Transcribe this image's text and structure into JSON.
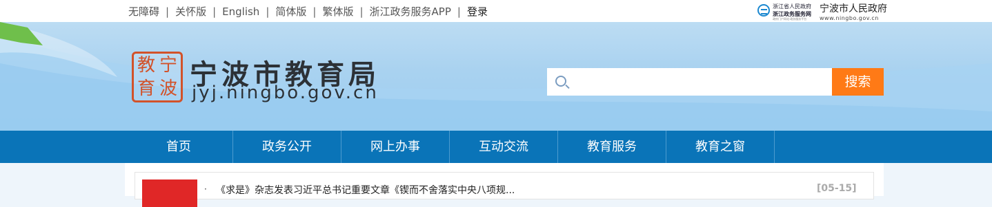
{
  "topbar": {
    "links": [
      "无障碍",
      "关怀版",
      "English",
      "简体版",
      "繁体版",
      "浙江政务服务APP"
    ],
    "separator": "|",
    "login": "登录"
  },
  "partner_logos": {
    "zhejiang": {
      "line1": "浙江省人民政府",
      "line2": "浙江政务服务网",
      "line3": "政府门户网站·政务服务平台"
    },
    "ningbo": {
      "name": "宁波市人民政府",
      "url": "www.ningbo.gov.cn"
    }
  },
  "header": {
    "seal_chars": [
      "宁",
      "波",
      "教",
      "育"
    ],
    "title": "宁波市教育局",
    "domain": "jyj.ningbo.gov.cn"
  },
  "search": {
    "placeholder": "",
    "button_label": "搜索"
  },
  "nav": {
    "items": [
      "首页",
      "政务公开",
      "网上办事",
      "互动交流",
      "教育服务",
      "教育之窗"
    ]
  },
  "news": {
    "items": [
      {
        "bullet": "·",
        "title": "《求是》杂志发表习近平总书记重要文章《锲而不舍落实中央八项规...",
        "date": "[05-15]"
      }
    ]
  },
  "colors": {
    "nav_bg": "#0a74b8",
    "search_btn": "#ff7a16",
    "seal": "#d2522a",
    "news_marker": "#e02727"
  }
}
